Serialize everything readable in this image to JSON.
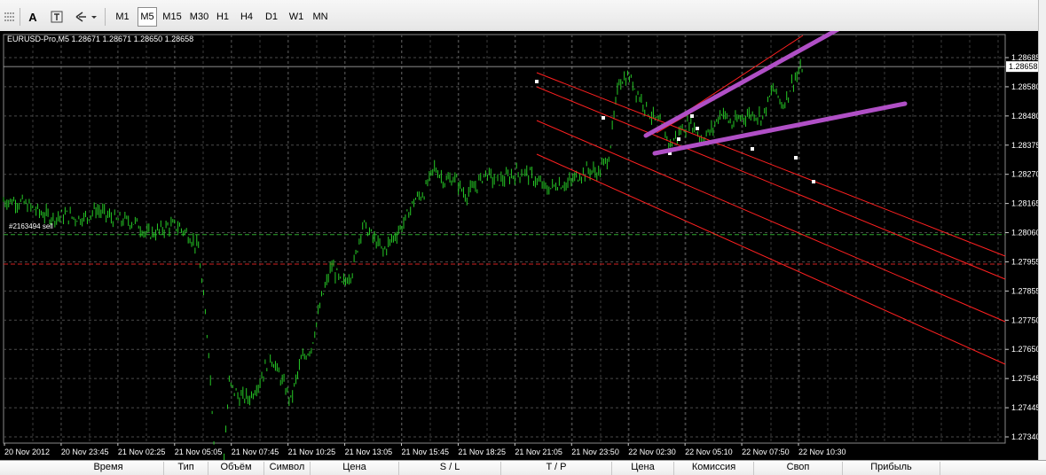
{
  "toolbar": {
    "cursor_icon": "crosshair-icon",
    "text_tool_label": "A",
    "text_label_icon": "text-label-icon",
    "arrows_icon": "arrows-dropdown-icon",
    "timeframes": [
      "M1",
      "M5",
      "M15",
      "M30",
      "H1",
      "H4",
      "D1",
      "W1",
      "MN"
    ],
    "active_timeframe": "M5"
  },
  "chart": {
    "symbol_info": "EURUSD-Pro,M5  1.28671 1.28671 1.28650 1.28658",
    "order_label": "#2163494 sell",
    "current_price": "1.28658",
    "colors": {
      "background": "#000000",
      "grid": "#4a4a4a",
      "candles": "#26c926",
      "channel": "#ff2020",
      "trendlines": "#b04fc6",
      "order_line": "#2fa82f",
      "stop_line": "#d02020"
    }
  },
  "chart_data": {
    "type": "line",
    "price_ticks": [
      "1.28685",
      "1.28580",
      "1.28480",
      "1.28375",
      "1.28270",
      "1.28165",
      "1.28060",
      "1.27955",
      "1.27855",
      "1.27750",
      "1.27650",
      "1.27545",
      "1.27445",
      "1.27340"
    ],
    "time_ticks": [
      "20 Nov 2012",
      "20 Nov 23:45",
      "21 Nov 02:25",
      "21 Nov 05:05",
      "21 Nov 07:45",
      "21 Nov 10:25",
      "21 Nov 13:05",
      "21 Nov 15:45",
      "21 Nov 18:25",
      "21 Nov 21:05",
      "21 Nov 23:50",
      "22 Nov 02:30",
      "22 Nov 05:10",
      "22 Nov 07:50",
      "22 Nov 10:30"
    ],
    "current_price": 1.28658,
    "order_price": 1.2806,
    "stop_price": 1.27955,
    "ylim": [
      1.2734,
      1.2869
    ],
    "series": [
      {
        "values": [
          1.2818,
          1.2818,
          1.2817,
          1.2815,
          1.2813,
          1.2812,
          1.2813,
          1.2812,
          1.2812,
          1.2815,
          1.2813,
          1.2811,
          1.2811,
          1.281,
          1.2806,
          1.2807,
          1.2809,
          1.2809,
          1.2806,
          1.2801,
          1.2765,
          1.2702,
          1.2753,
          1.2748,
          1.2748,
          1.2754,
          1.2763,
          1.2755,
          1.2747,
          1.2761,
          1.2766,
          1.2783,
          1.2795,
          1.2788,
          1.2793,
          1.281,
          1.2805,
          1.28,
          1.2805,
          1.281,
          1.2818,
          1.2821,
          1.283,
          1.2825,
          1.2826,
          1.282,
          1.2823,
          1.2828,
          1.2825,
          1.2826,
          1.2828,
          1.2828,
          1.2825,
          1.2822,
          1.2824,
          1.2824,
          1.2827,
          1.2829,
          1.2828,
          1.2834,
          1.2861,
          1.2862,
          1.2855,
          1.2849,
          1.2845,
          1.2838,
          1.2843,
          1.2846,
          1.284,
          1.2843,
          1.285,
          1.2845,
          1.2848,
          1.2849,
          1.2848,
          1.2858,
          1.2852,
          1.2861,
          1.2866
        ]
      }
    ]
  },
  "terminal": {
    "columns": [
      "Время",
      "Тип",
      "Объём",
      "Символ",
      "Цена",
      "S / L",
      "T / P",
      "Цена",
      "Комиссия",
      "Своп",
      "Прибыль"
    ]
  }
}
